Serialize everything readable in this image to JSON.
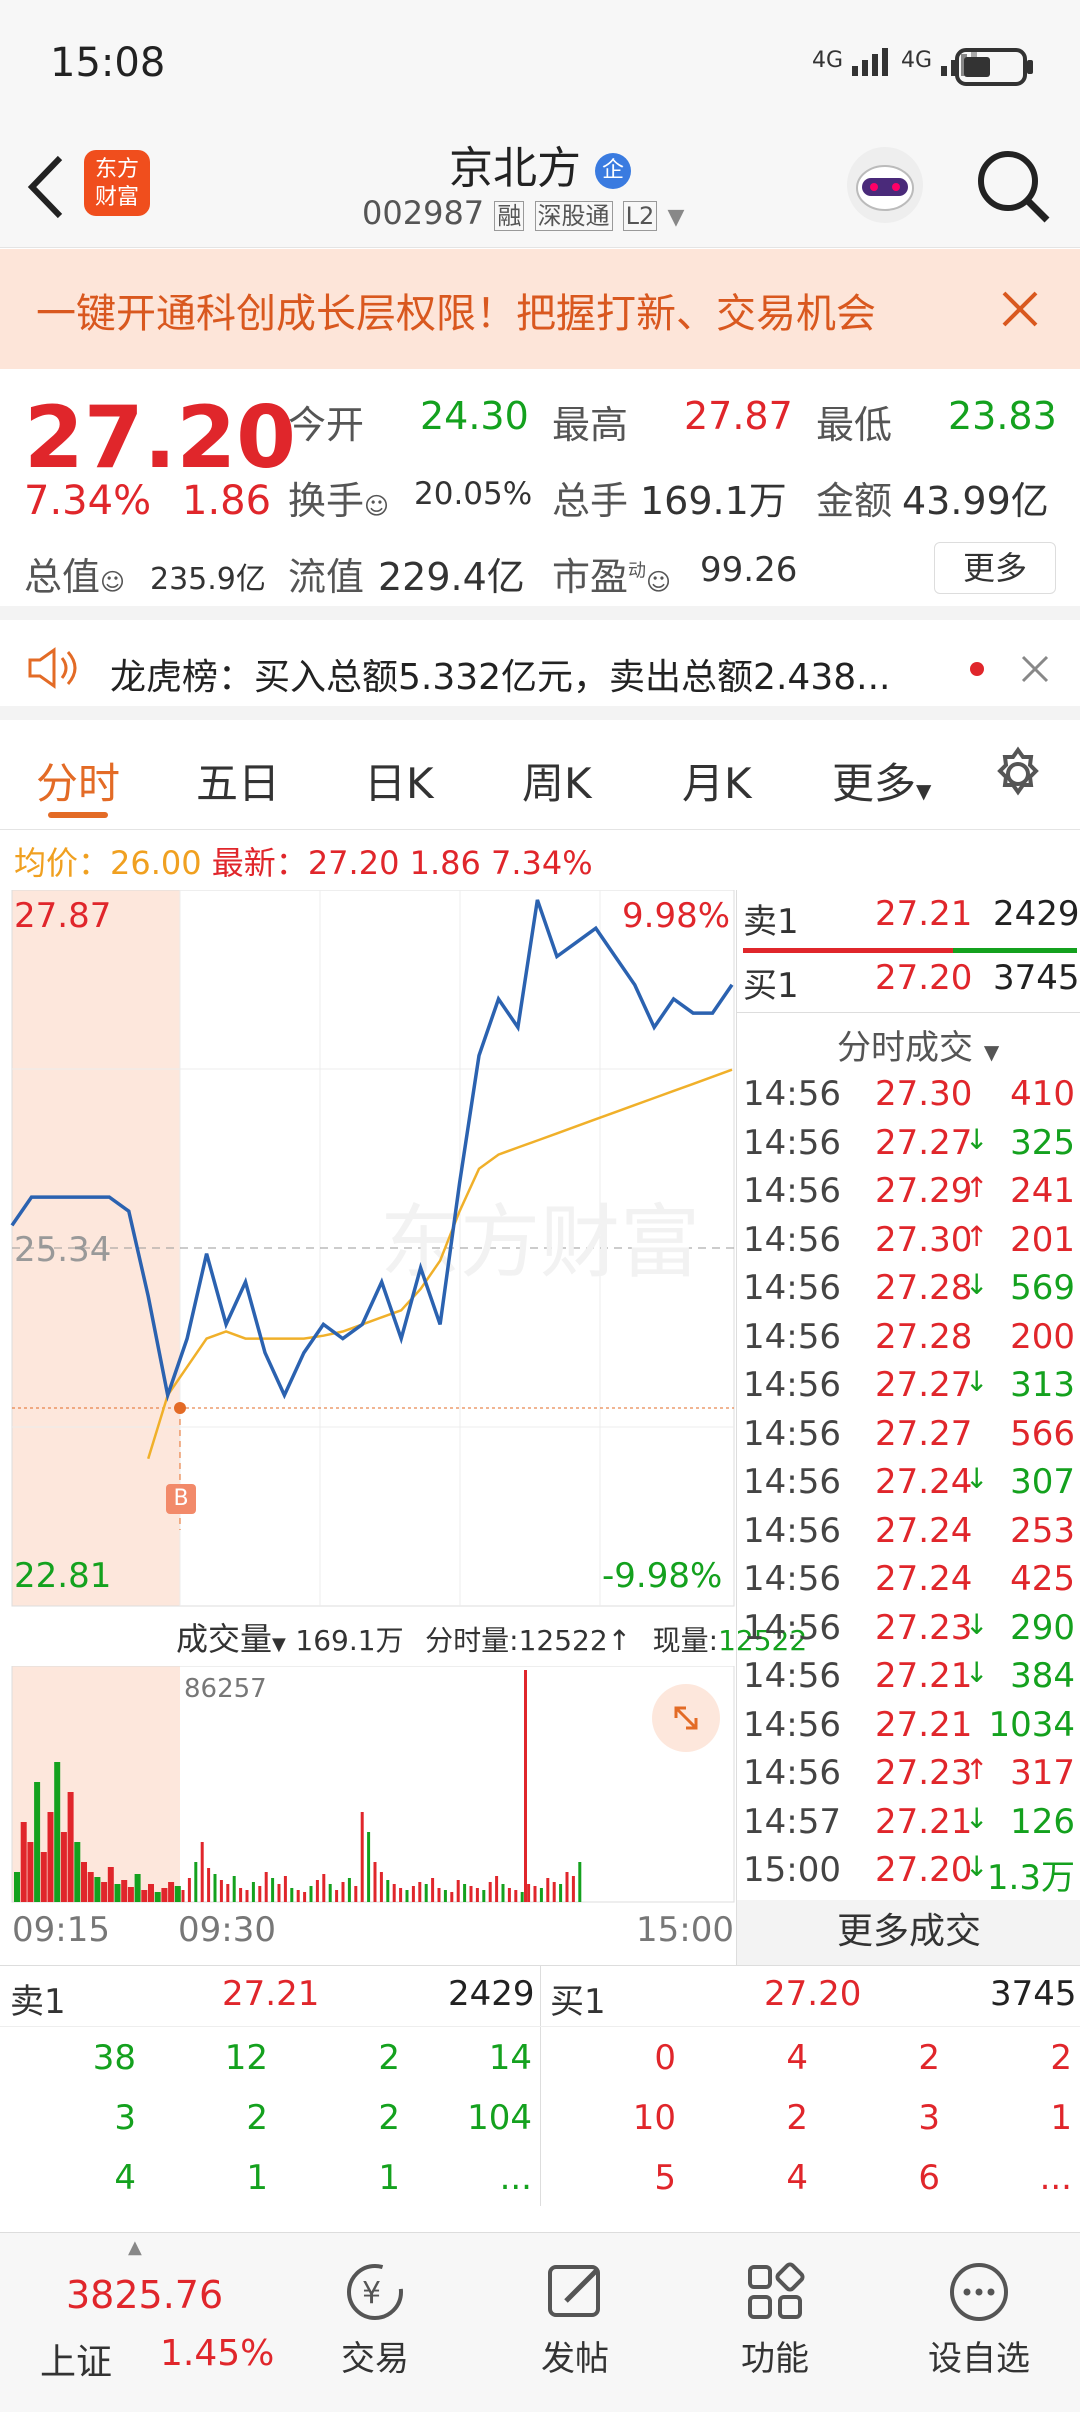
{
  "status_bar": {
    "time": "15:08",
    "signal1": "4G",
    "signal2": "4G"
  },
  "header": {
    "title": "京北方",
    "title_badge": "企",
    "code": "002987",
    "tags": [
      "融",
      "深股通",
      "L2"
    ],
    "logo_text_line1": "东方",
    "logo_text_line2": "财富"
  },
  "banner": {
    "text": "一键开通科创成长层权限！把握打新、交易机会"
  },
  "quote": {
    "price": "27.20",
    "change_pct": "7.34%",
    "change": "1.86",
    "open_label": "今开",
    "open": "24.30",
    "high_label": "最高",
    "high": "27.87",
    "low_label": "最低",
    "low": "23.83",
    "turnover_label": "换手",
    "turnover": "20.05%",
    "volume_label": "总手",
    "volume": "169.1万",
    "amount_label": "金额",
    "amount": "43.99亿",
    "mktcap_label": "总值",
    "mktcap": "235.9亿",
    "float_label": "流值",
    "float": "229.4亿",
    "pe_label": "市盈",
    "pe_sup": "动",
    "pe": "99.26",
    "more": "更多"
  },
  "notice": {
    "text": "龙虎榜：买入总额5.332亿元，卖出总额2.438..."
  },
  "tabs": [
    "分时",
    "五日",
    "日K",
    "周K",
    "月K",
    "更多"
  ],
  "chart": {
    "avg_label": "均价：",
    "avg": "26.00",
    "latest_label": "最新：",
    "latest": "27.20",
    "latest_change": "1.86",
    "latest_pct": "7.34%",
    "y_high": "27.87",
    "y_mid": "25.34",
    "y_low": "22.81",
    "pct_high": "9.98%",
    "pct_low": "-9.98%",
    "vol_label": "成交量",
    "vol_total": "169.1万",
    "vol_minute_label": "分时量:",
    "vol_minute": "12522",
    "vol_now_label": "现量:",
    "vol_now": "12522",
    "vol_max": "86257",
    "x_labels": [
      "09:15",
      "09:30",
      "15:00"
    ],
    "marker": "B",
    "watermark": "东方财富"
  },
  "chart_data": {
    "type": "line",
    "title": "",
    "xlabel": "",
    "ylabel": "",
    "x_ticks": [
      "09:15",
      "09:30",
      "15:00"
    ],
    "ylim": [
      22.81,
      27.87
    ],
    "reference_price": 25.34,
    "series": [
      {
        "name": "",
        "values": [
          25.5,
          25.7,
          25.7,
          25.7,
          25.7,
          25.7,
          25.6,
          25.0,
          24.3,
          24.7,
          25.3,
          24.8,
          25.1,
          24.6,
          24.3,
          24.6,
          24.8,
          24.7,
          24.8,
          25.1,
          24.7,
          25.2,
          24.8,
          25.8,
          26.7,
          27.1,
          26.9,
          27.8,
          27.4,
          27.5,
          27.6,
          27.4,
          27.2,
          26.9,
          27.1,
          27.0,
          27.0,
          27.2
        ]
      },
      {
        "name": "",
        "values": [
          null,
          null,
          null,
          null,
          null,
          null,
          null,
          23.85,
          24.3,
          24.5,
          24.7,
          24.75,
          24.7,
          24.7,
          24.7,
          24.7,
          24.72,
          24.75,
          24.8,
          24.85,
          24.9,
          25.05,
          25.25,
          25.6,
          25.9,
          26.0,
          26.05,
          26.1,
          26.15,
          26.2,
          26.25,
          26.3,
          26.35,
          26.4,
          26.45,
          26.5,
          26.55,
          26.6
        ]
      }
    ]
  },
  "level1": {
    "sell_label": "卖1",
    "sell_price": "27.21",
    "sell_vol": "2429",
    "buy_label": "买1",
    "buy_price": "27.20",
    "buy_vol": "3745"
  },
  "ticks_header": "分时成交",
  "ticks": [
    {
      "time": "14:56",
      "price": "27.30",
      "arrow": "",
      "vol": "410",
      "color": "red"
    },
    {
      "time": "14:56",
      "price": "27.27",
      "arrow": "↓",
      "vol": "325",
      "color": "green"
    },
    {
      "time": "14:56",
      "price": "27.29",
      "arrow": "↑",
      "vol": "241",
      "color": "red"
    },
    {
      "time": "14:56",
      "price": "27.30",
      "arrow": "↑",
      "vol": "201",
      "color": "red"
    },
    {
      "time": "14:56",
      "price": "27.28",
      "arrow": "↓",
      "vol": "569",
      "color": "green"
    },
    {
      "time": "14:56",
      "price": "27.28",
      "arrow": "",
      "vol": "200",
      "color": "red"
    },
    {
      "time": "14:56",
      "price": "27.27",
      "arrow": "↓",
      "vol": "313",
      "color": "green"
    },
    {
      "time": "14:56",
      "price": "27.27",
      "arrow": "",
      "vol": "566",
      "color": "red"
    },
    {
      "time": "14:56",
      "price": "27.24",
      "arrow": "↓",
      "vol": "307",
      "color": "green"
    },
    {
      "time": "14:56",
      "price": "27.24",
      "arrow": "",
      "vol": "253",
      "color": "red"
    },
    {
      "time": "14:56",
      "price": "27.24",
      "arrow": "",
      "vol": "425",
      "color": "red"
    },
    {
      "time": "14:56",
      "price": "27.23",
      "arrow": "↓",
      "vol": "290",
      "color": "green"
    },
    {
      "time": "14:56",
      "price": "27.21",
      "arrow": "↓",
      "vol": "384",
      "color": "green"
    },
    {
      "time": "14:56",
      "price": "27.21",
      "arrow": "",
      "vol": "1034",
      "color": "green"
    },
    {
      "time": "14:56",
      "price": "27.23",
      "arrow": "↑",
      "vol": "317",
      "color": "red"
    },
    {
      "time": "14:57",
      "price": "27.21",
      "arrow": "↓",
      "vol": "126",
      "color": "green"
    },
    {
      "time": "15:00",
      "price": "27.20",
      "arrow": "↓",
      "vol": "1.3万",
      "color": "green"
    }
  ],
  "more_ticks": "更多成交",
  "orderbook": {
    "sell_label": "卖1",
    "sell_price": "27.21",
    "sell_vol": "2429",
    "buy_label": "买1",
    "buy_price": "27.20",
    "buy_vol": "3745",
    "sell_rows": [
      [
        "38",
        "12",
        "2",
        "14"
      ],
      [
        "3",
        "2",
        "2",
        "104"
      ],
      [
        "4",
        "1",
        "1",
        "..."
      ]
    ],
    "buy_rows": [
      [
        "0",
        "4",
        "2",
        "2"
      ],
      [
        "10",
        "2",
        "3",
        "1"
      ],
      [
        "5",
        "4",
        "6",
        "..."
      ]
    ]
  },
  "bottom": {
    "index_value": "3825.76",
    "index_name": "上证",
    "index_pct": "1.45%",
    "nav": [
      "交易",
      "发帖",
      "功能",
      "设自选"
    ]
  },
  "colors": {
    "red": "#e0262b",
    "green": "#14a11e",
    "blue": "#2b62b0",
    "avg_line": "#f0b02a"
  }
}
